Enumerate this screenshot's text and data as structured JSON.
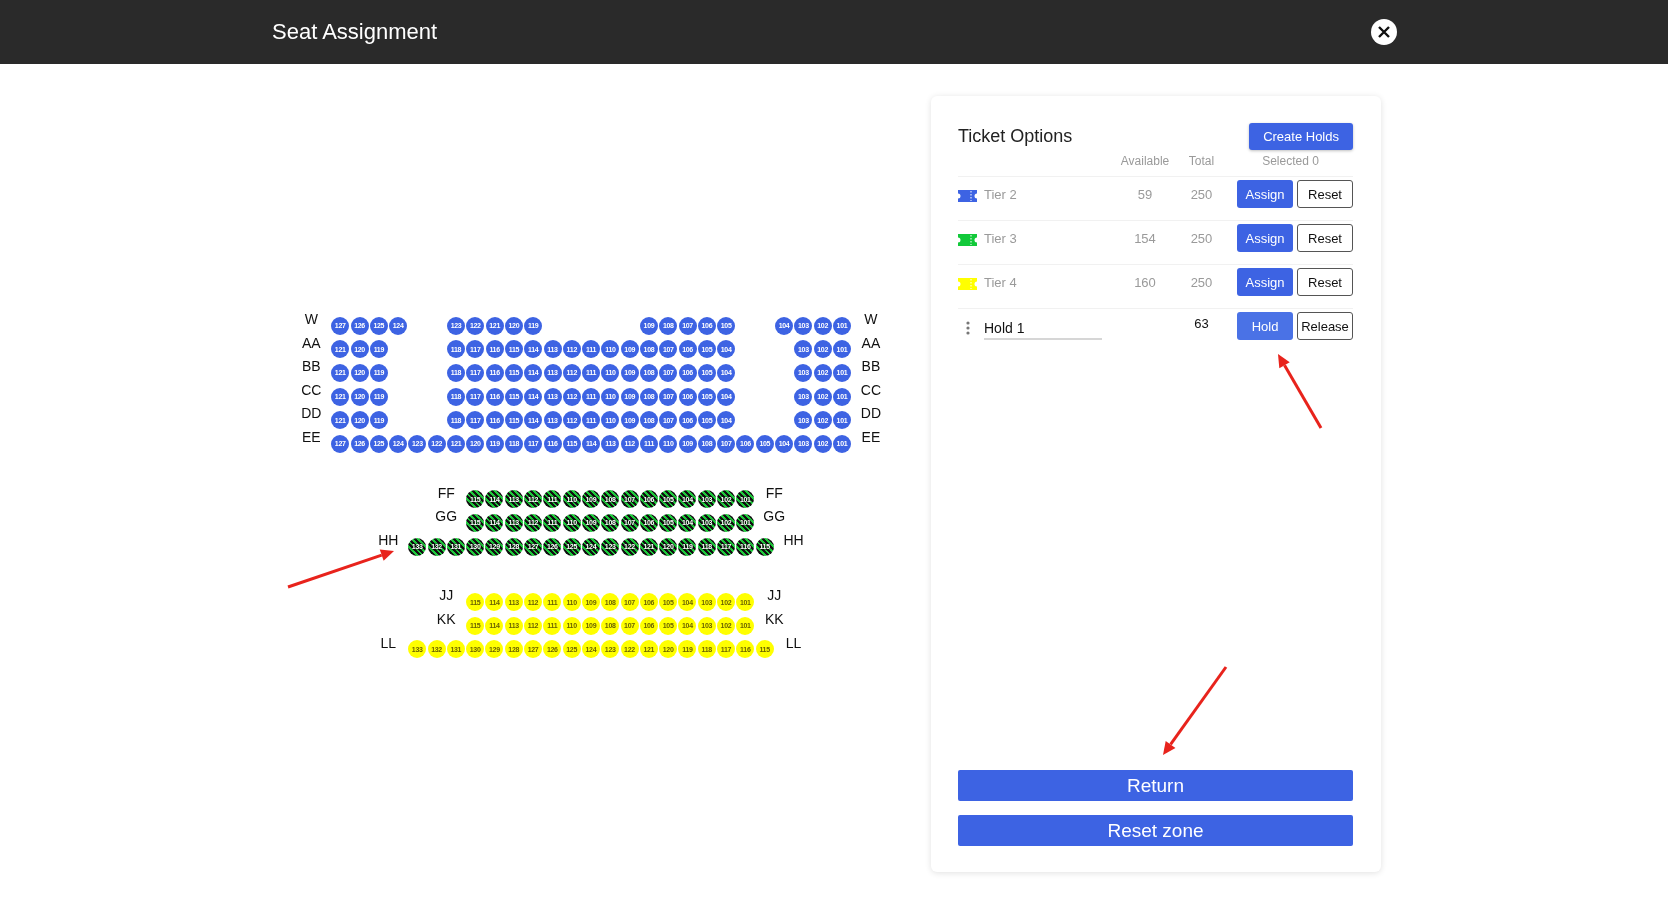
{
  "header": {
    "title": "Seat Assignment"
  },
  "seat_map": {
    "sections": [
      {
        "color": "#3d63e3",
        "held": false,
        "rows": [
          {
            "label_left": "W",
            "label_right": "W",
            "blocks": [
              [
                "127",
                "126",
                "125",
                "124"
              ],
              [
                "123",
                "122",
                "121",
                "120",
                "119"
              ],
              [
                "109",
                "108",
                "107",
                "106",
                "105"
              ],
              [
                "104",
                "103",
                "102",
                "101"
              ]
            ]
          },
          {
            "label_left": "AA",
            "label_right": "AA",
            "blocks": [
              [
                "121",
                "120",
                "119"
              ],
              [
                "118",
                "117",
                "116",
                "115",
                "114",
                "113",
                "112",
                "111",
                "110",
                "109",
                "108",
                "107",
                "106",
                "105",
                "104"
              ],
              [
                "103",
                "102",
                "101"
              ]
            ]
          },
          {
            "label_left": "BB",
            "label_right": "BB",
            "blocks": [
              [
                "121",
                "120",
                "119"
              ],
              [
                "118",
                "117",
                "116",
                "115",
                "114",
                "113",
                "112",
                "111",
                "110",
                "109",
                "108",
                "107",
                "106",
                "105",
                "104"
              ],
              [
                "103",
                "102",
                "101"
              ]
            ]
          },
          {
            "label_left": "CC",
            "label_right": "CC",
            "blocks": [
              [
                "121",
                "120",
                "119"
              ],
              [
                "118",
                "117",
                "116",
                "115",
                "114",
                "113",
                "112",
                "111",
                "110",
                "109",
                "108",
                "107",
                "106",
                "105",
                "104"
              ],
              [
                "103",
                "102",
                "101"
              ]
            ]
          },
          {
            "label_left": "DD",
            "label_right": "DD",
            "blocks": [
              [
                "121",
                "120",
                "119"
              ],
              [
                "118",
                "117",
                "116",
                "115",
                "114",
                "113",
                "112",
                "111",
                "110",
                "109",
                "108",
                "107",
                "106",
                "105",
                "104"
              ],
              [
                "103",
                "102",
                "101"
              ]
            ]
          },
          {
            "label_left": "EE",
            "label_right": "EE",
            "blocks": [
              [
                "127",
                "126",
                "125",
                "124",
                "123",
                "122",
                "121",
                "120",
                "119",
                "118",
                "117",
                "116",
                "115",
                "114",
                "113",
                "112",
                "111",
                "110",
                "109",
                "108",
                "107",
                "106",
                "105",
                "104",
                "103",
                "102",
                "101"
              ]
            ]
          }
        ]
      },
      {
        "color": "#1fc93c",
        "held": true,
        "rows": [
          {
            "label_left": "FF",
            "label_right": "FF",
            "blocks": [
              [
                "115",
                "114",
                "113",
                "112",
                "111",
                "110",
                "109",
                "108",
                "107",
                "106",
                "105",
                "104",
                "103",
                "102",
                "101"
              ]
            ]
          },
          {
            "label_left": "GG",
            "label_right": "GG",
            "blocks": [
              [
                "115",
                "114",
                "113",
                "112",
                "111",
                "110",
                "109",
                "108",
                "107",
                "106",
                "105",
                "104",
                "103",
                "102",
                "101"
              ]
            ]
          },
          {
            "label_left": "HH",
            "label_right": "HH",
            "blocks": [
              [
                "133",
                "132",
                "131",
                "130",
                "129",
                "128",
                "127",
                "126",
                "125",
                "124",
                "123",
                "122",
                "121",
                "120",
                "119",
                "118",
                "117",
                "116",
                "115"
              ]
            ]
          }
        ]
      },
      {
        "color": "#ffff00",
        "held": false,
        "rows": [
          {
            "label_left": "JJ",
            "label_right": "JJ",
            "blocks": [
              [
                "115",
                "114",
                "113",
                "112",
                "111",
                "110",
                "109",
                "108",
                "107",
                "106",
                "105",
                "104",
                "103",
                "102",
                "101"
              ]
            ]
          },
          {
            "label_left": "KK",
            "label_right": "KK",
            "blocks": [
              [
                "115",
                "114",
                "113",
                "112",
                "111",
                "110",
                "109",
                "108",
                "107",
                "106",
                "105",
                "104",
                "103",
                "102",
                "101"
              ]
            ]
          },
          {
            "label_left": "LL",
            "label_right": "LL",
            "blocks": [
              [
                "133",
                "132",
                "131",
                "130",
                "129",
                "128",
                "127",
                "126",
                "125",
                "124",
                "123",
                "122",
                "121",
                "120",
                "119",
                "118",
                "117",
                "116",
                "115"
              ]
            ]
          }
        ]
      }
    ]
  },
  "ticket_options": {
    "title": "Ticket Options",
    "create_button": "Create Holds",
    "columns": [
      "Available",
      "Total",
      "Selected 0"
    ],
    "options": [
      {
        "kind": "tier",
        "name": "Tier 2",
        "color": "#3d63e3",
        "available": "59",
        "total": "250",
        "buttons": [
          "Assign",
          "Reset"
        ]
      },
      {
        "kind": "tier",
        "name": "Tier 3",
        "color": "#12c93a",
        "available": "154",
        "total": "250",
        "buttons": [
          "Assign",
          "Reset"
        ]
      },
      {
        "kind": "tier",
        "name": "Tier 4",
        "color": "#ffff00",
        "available": "160",
        "total": "250",
        "buttons": [
          "Assign",
          "Reset"
        ]
      },
      {
        "kind": "hold",
        "name": "Hold 1",
        "total": "63",
        "buttons": [
          "Hold",
          "Release"
        ]
      }
    ],
    "footer_buttons": [
      "Return",
      "Reset zone"
    ]
  }
}
